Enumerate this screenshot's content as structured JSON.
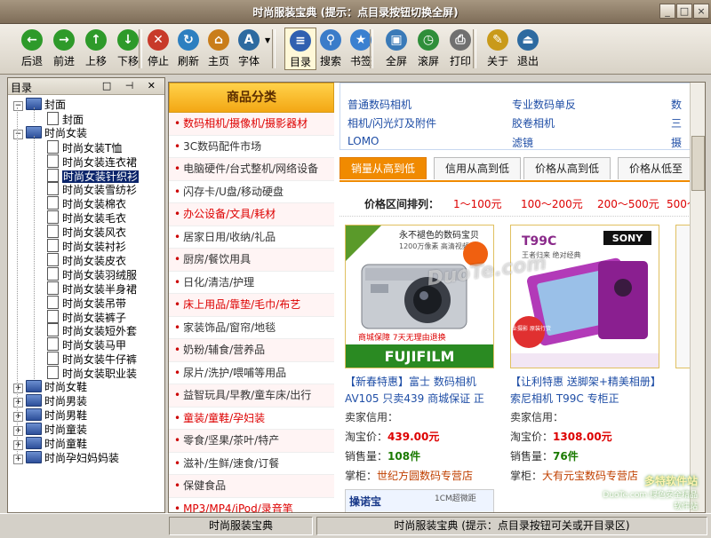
{
  "window": {
    "title": "时尚服装宝典 (提示：点目录按钮切换全屏)",
    "controls": [
      "_",
      "□",
      "×"
    ]
  },
  "toolbar": {
    "buttons": [
      {
        "label": "后退",
        "icon": "back-arrow-icon",
        "glyph": "←",
        "color": "#2e9a2a"
      },
      {
        "label": "前进",
        "icon": "forward-arrow-icon",
        "glyph": "→",
        "color": "#2e9a2a"
      },
      {
        "label": "上移",
        "icon": "up-arrow-icon",
        "glyph": "↑",
        "color": "#2e9a2a"
      },
      {
        "label": "下移",
        "icon": "down-arrow-icon",
        "glyph": "↓",
        "color": "#2e9a2a"
      },
      {
        "label": "停止",
        "icon": "stop-icon",
        "glyph": "✕",
        "color": "#c83a2a"
      },
      {
        "label": "刷新",
        "icon": "refresh-icon",
        "glyph": "↻",
        "color": "#2d7fc0"
      },
      {
        "label": "主页",
        "icon": "home-icon",
        "glyph": "⌂",
        "color": "#c97d1a"
      },
      {
        "label": "字体",
        "icon": "font-icon",
        "glyph": "A",
        "color": "#2d6aa0"
      },
      {
        "label": "目录",
        "icon": "contents-icon",
        "glyph": "≡",
        "color": "#3060b0"
      },
      {
        "label": "搜索",
        "icon": "search-icon",
        "glyph": "⚲",
        "color": "#3a7cc9"
      },
      {
        "label": "书签",
        "icon": "bookmark-star-icon",
        "glyph": "★",
        "color": "#3a80d0"
      },
      {
        "label": "全屏",
        "icon": "fullscreen-icon",
        "glyph": "▣",
        "color": "#3a7ab8"
      },
      {
        "label": "滚屏",
        "icon": "autoscroll-icon",
        "glyph": "◷",
        "color": "#2f8e3a"
      },
      {
        "label": "打印",
        "icon": "printer-icon",
        "glyph": "⎙",
        "color": "#707070"
      },
      {
        "label": "关于",
        "icon": "about-icon",
        "glyph": "✎",
        "color": "#c99a1a"
      },
      {
        "label": "退出",
        "icon": "exit-icon",
        "glyph": "⏏",
        "color": "#2d6aa0"
      }
    ]
  },
  "toc": {
    "title": "目录",
    "header_buttons": "□ ⊣ ✕",
    "items": [
      {
        "label": "封面",
        "type": "book",
        "expanded": true
      },
      {
        "label": "封面",
        "type": "page"
      },
      {
        "label": "时尚女装",
        "type": "book",
        "expanded": true
      },
      {
        "label": "时尚女装T恤",
        "type": "page"
      },
      {
        "label": "时尚女装连衣裙",
        "type": "page"
      },
      {
        "label": "时尚女装针织衫",
        "type": "page",
        "selected": true
      },
      {
        "label": "时尚女装雪纺衫",
        "type": "page"
      },
      {
        "label": "时尚女装棉衣",
        "type": "page"
      },
      {
        "label": "时尚女装毛衣",
        "type": "page"
      },
      {
        "label": "时尚女装风衣",
        "type": "page"
      },
      {
        "label": "时尚女装衬衫",
        "type": "page"
      },
      {
        "label": "时尚女装皮衣",
        "type": "page"
      },
      {
        "label": "时尚女装羽绒服",
        "type": "page"
      },
      {
        "label": "时尚女装半身裙",
        "type": "page"
      },
      {
        "label": "时尚女装吊带",
        "type": "page"
      },
      {
        "label": "时尚女装裤子",
        "type": "page"
      },
      {
        "label": "时尚女装短外套",
        "type": "page"
      },
      {
        "label": "时尚女装马甲",
        "type": "page"
      },
      {
        "label": "时尚女装牛仔裤",
        "type": "page"
      },
      {
        "label": "时尚女装职业装",
        "type": "page"
      },
      {
        "label": "时尚女鞋",
        "type": "book"
      },
      {
        "label": "时尚男装",
        "type": "book"
      },
      {
        "label": "时尚男鞋",
        "type": "book"
      },
      {
        "label": "时尚童装",
        "type": "book"
      },
      {
        "label": "时尚童鞋",
        "type": "book"
      },
      {
        "label": "时尚孕妇妈妈装",
        "type": "book"
      }
    ]
  },
  "categories": {
    "title": "商品分类",
    "items": [
      {
        "label": "数码相机/摄像机/摄影器材",
        "red": true
      },
      {
        "label": "3C数码配件市场",
        "red": false
      },
      {
        "label": "电脑硬件/台式整机/网络设备",
        "red": false
      },
      {
        "label": "闪存卡/U盘/移动硬盘",
        "red": false
      },
      {
        "label": "办公设备/文具/耗材",
        "red": true
      },
      {
        "label": "居家日用/收纳/礼品",
        "red": false
      },
      {
        "label": "厨房/餐饮用具",
        "red": false
      },
      {
        "label": "日化/清洁/护理",
        "red": false
      },
      {
        "label": "床上用品/靠垫/毛巾/布艺",
        "red": true
      },
      {
        "label": "家装饰品/窗帘/地毯",
        "red": false
      },
      {
        "label": "奶粉/辅食/营养品",
        "red": false
      },
      {
        "label": "尿片/洗护/喂哺等用品",
        "red": false
      },
      {
        "label": "益智玩具/早教/童车床/出行",
        "red": false
      },
      {
        "label": "童装/童鞋/孕妇装",
        "red": true
      },
      {
        "label": "零食/坚果/茶叶/特产",
        "red": false
      },
      {
        "label": "滋补/生鲜/速食/订餐",
        "red": false
      },
      {
        "label": "保健食品",
        "red": false
      },
      {
        "label": "MP3/MP4/iPod/录音笔",
        "red": true
      }
    ]
  },
  "sublinks": [
    "普通数码相机",
    "专业数码单反",
    "数",
    "相机/闪光灯及附件",
    "胶卷相机",
    "三",
    "LOMO",
    "滤镜",
    "摄"
  ],
  "sort_tabs": [
    {
      "label": "销量从高到低",
      "active": true
    },
    {
      "label": "信用从高到低",
      "active": false
    },
    {
      "label": "价格从高到低",
      "active": false
    },
    {
      "label": "价格从低至",
      "active": false
    }
  ],
  "price_filter": {
    "label": "价格区间排列：",
    "ranges": [
      "1～100元",
      "100～200元",
      "200～500元",
      "500～"
    ]
  },
  "products": [
    {
      "image_text": [
        "永不褪色的数码宝贝",
        "1200万像素 高清视频",
        "商城保障 7天无理由退换",
        "FUJIFILM"
      ],
      "title": "【新春特惠】富士 数码相机 AV105 只卖439 商城保证 正",
      "seller_label": "卖家信用：",
      "price_label": "淘宝价：",
      "price": "439.00元",
      "sales_label": "销售量：",
      "sales": "108件",
      "shop_label": "掌柜：",
      "shop": "世纪方圆数码专营店"
    },
    {
      "image_text": [
        "T99C",
        "SONY",
        "王者归来 绝对经典",
        "专业摄影 原装行货"
      ],
      "title": "【让利特惠 送脚架+精美相册】索尼相机 T99C 专柜正",
      "seller_label": "卖家信用：",
      "price_label": "淘宝价：",
      "price": "1308.00元",
      "sales_label": "销售量：",
      "sales": "76件",
      "shop_label": "掌柜：",
      "shop": "大有元宝数码专营店"
    }
  ],
  "bottom_promo": [
    "操诺宝",
    "1CM超微距"
  ],
  "watermarks": [
    "DuoTe.com",
    "多特软件站",
    "DuoTe.com 绿色安全精品软件站"
  ],
  "status": {
    "left": "时尚服装宝典",
    "right": "时尚服装宝典 (提示：点目录按钮可关或开目录区)"
  }
}
